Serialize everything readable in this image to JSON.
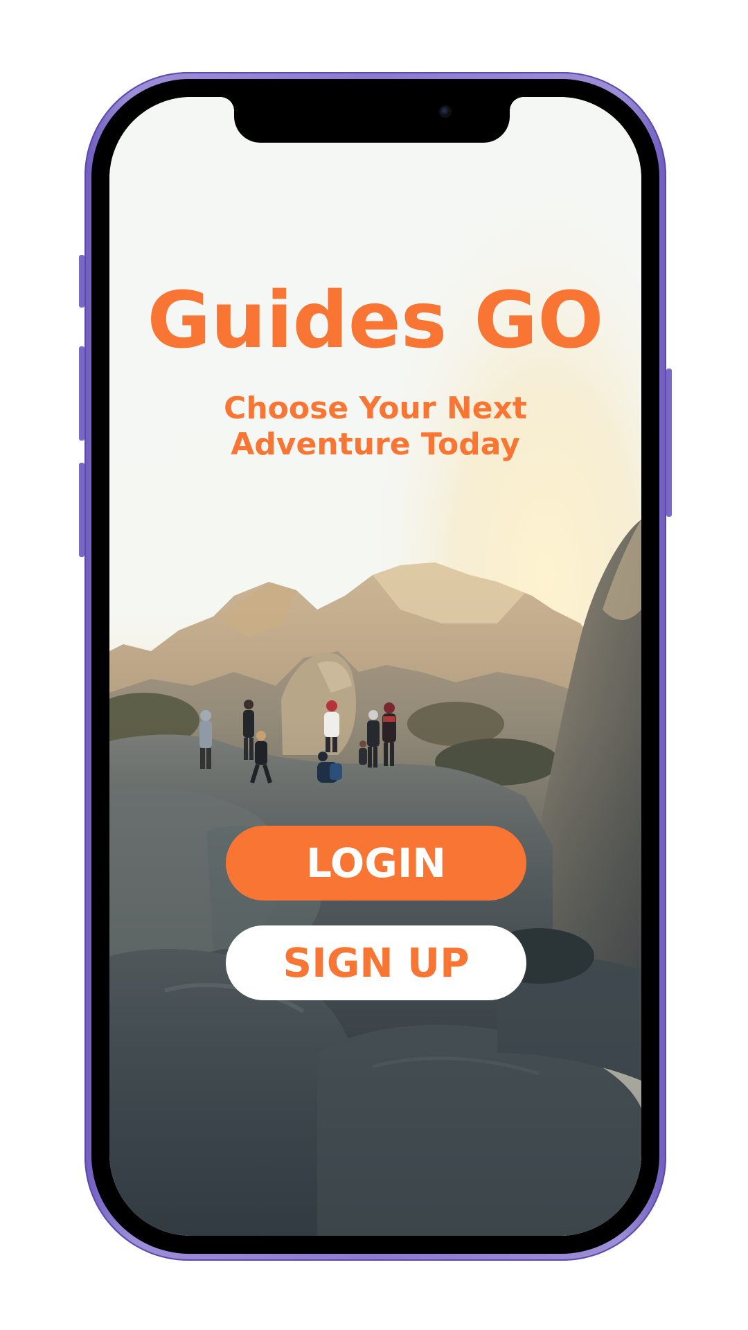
{
  "app": {
    "title": "Guides GO",
    "tagline_line1": "Choose Your Next",
    "tagline_line2": "Adventure Today"
  },
  "actions": {
    "login_label": "LOGIN",
    "signup_label": "SIGN UP"
  },
  "colors": {
    "brand_orange": "#f97534",
    "phone_frame": "#8d7bd0",
    "screen_background": "#f5f7f4",
    "signup_background": "#ffffff"
  },
  "background_photo": {
    "subject": "group-of-hikers-on-rocks"
  }
}
